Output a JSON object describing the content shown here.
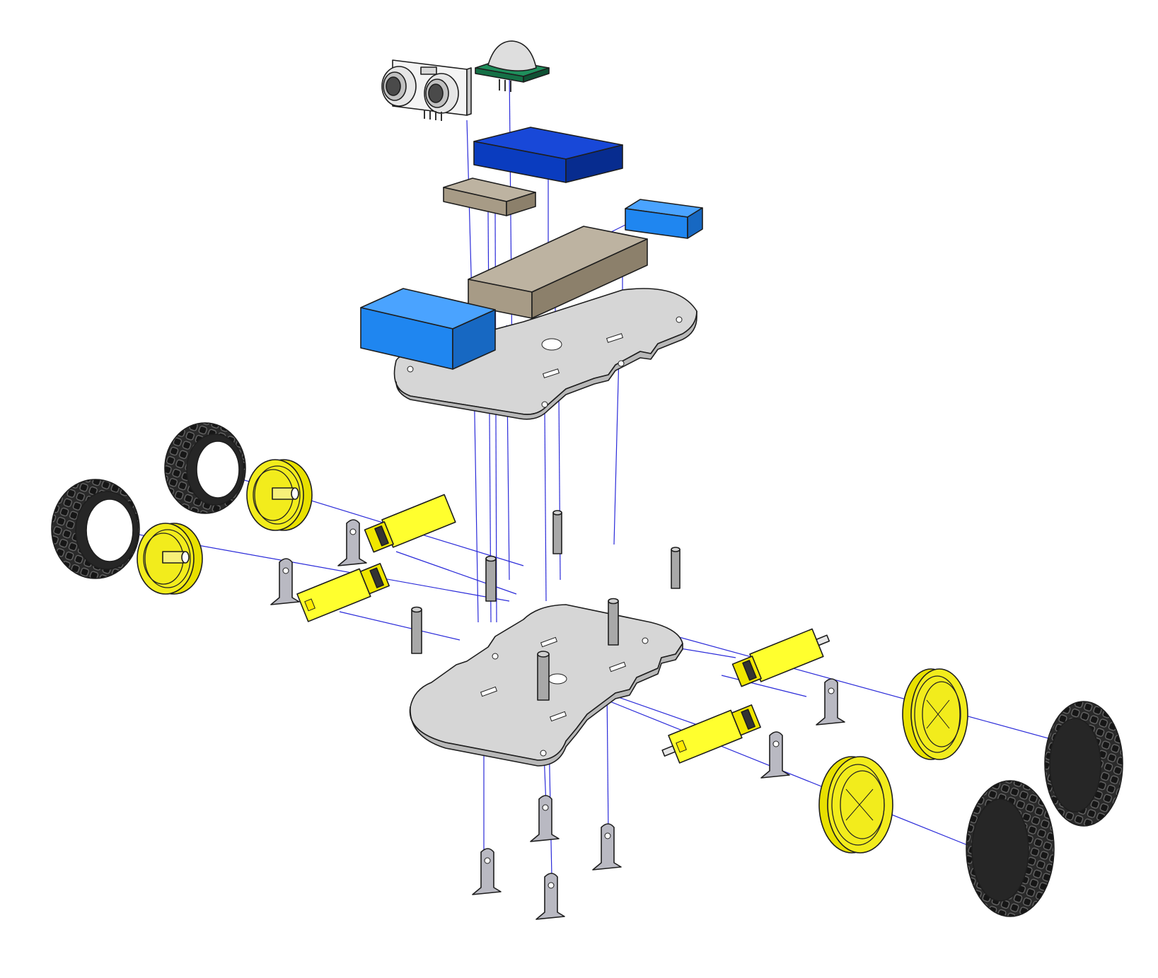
{
  "colors": {
    "background": "#ffffff",
    "chassis_plate": "#d6d6d6",
    "standoff": "#a8a8a8",
    "bracket": "#b9b9c2",
    "gear_motor": "#ffff2e",
    "wheel_hub": "#f2ec1c",
    "tire": "#2c2c2c",
    "battery_pack": "#1f86f0",
    "motor_driver": "#0a3cbf",
    "controller_board": "#a79b86",
    "small_module": "#1f86f0",
    "pir_sensor_board": "#1f8f5c",
    "ultrasonic_sensor": "#f2f2f2",
    "assembly_lines": "#2b2bd9"
  },
  "icons": {
    "ultrasonic_sensor": "ultrasonic-sensor-icon",
    "pir_sensor": "pir-sensor-icon",
    "motor": "gear-motor-icon",
    "wheel": "wheel-icon",
    "tire": "tire-icon"
  }
}
